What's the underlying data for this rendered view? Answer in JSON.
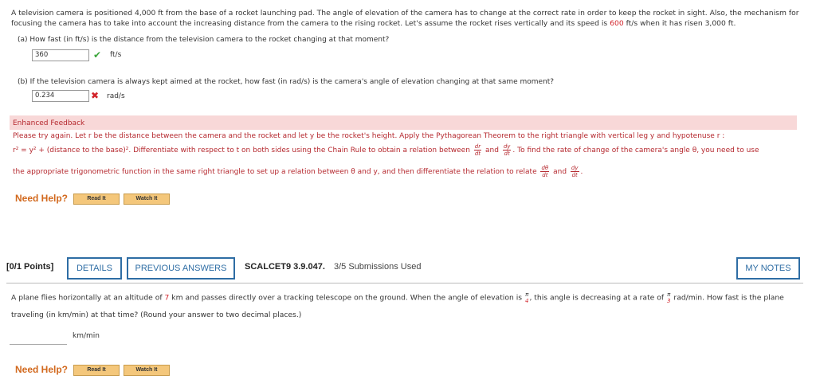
{
  "problem1": {
    "intro_a": "A television camera is positioned 4,000 ft from the base of a rocket launching pad. The angle of elevation of the camera has to change at the correct rate in order to keep the rocket in sight. Also, the mechanism for focusing the camera has to take into account the increasing distance from the camera to the rising rocket. Let's assume the rocket rises vertically and its speed is ",
    "speed": "600",
    "intro_b": " ft/s when it has risen 3,000 ft.",
    "qa": "(a)   How fast (in ft/s) is the distance from the television camera to the rocket changing at that moment?",
    "qa_answer": "360",
    "qa_unit": "ft/s",
    "qb": "(b)   If the television camera is always kept aimed at the rocket, how fast (in rad/s) is the camera's angle of elevation changing at that same moment?",
    "qb_answer": "0.234",
    "qb_unit": "rad/s"
  },
  "feedback": {
    "title": "Enhanced Feedback",
    "line1": "Please try again. Let r be the distance between the camera and the rocket and let y be the rocket's height. Apply the Pythagorean Theorem to the right triangle with vertical leg y and hypotenuse r :",
    "line2a": "r² = y² + (distance to the base)². Differentiate with respect to t on both sides using the Chain Rule to obtain a relation between",
    "and": "and",
    "line2b": ". To find the rate of change of the camera's angle θ, you need to use",
    "line3a": "the appropriate trigonometric function in the same right triangle to set up a relation between θ and y, and then differentiate the relation to relate",
    "frac_dr_n": "dr",
    "frac_dr_d": "dt",
    "frac_dy_n": "dy",
    "frac_dy_d": "dt",
    "frac_dth_n": "dθ",
    "frac_dth_d": "dt"
  },
  "help1": {
    "label": "Need Help?",
    "read": "Read It",
    "watch": "Watch It"
  },
  "problem2": {
    "points": "[0/1 Points]",
    "details": "DETAILS",
    "previous": "PREVIOUS ANSWERS",
    "code": "SCALCET9 3.9.047.",
    "submissions": "3/5 Submissions Used",
    "notes": "MY NOTES",
    "text_a": "A plane flies horizontally at an altitude of ",
    "altitude": "7",
    "text_b": " km and passes directly over a tracking telescope on the ground. When the angle of elevation is",
    "angle_n": "π",
    "angle_d": "4",
    "text_c": ", this angle is decreasing at a rate of",
    "rate_n": "π",
    "rate_d": "3",
    "text_d": " rad/min. How fast is the plane",
    "text_e": "traveling (in km/min) at that time? (Round your answer to two decimal places.)",
    "unit": "km/min"
  },
  "help2": {
    "label": "Need Help?",
    "read": "Read It",
    "watch": "Watch It"
  }
}
